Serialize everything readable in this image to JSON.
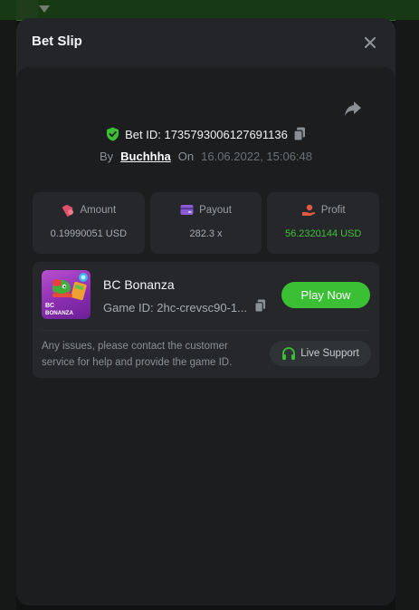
{
  "modal": {
    "title": "Bet Slip",
    "close_icon": "close-icon",
    "share_icon": "share-icon"
  },
  "bet": {
    "id_label": "Bet ID: 1735793006127691136",
    "by_label": "By",
    "user": "Buchhha",
    "on_label": "On",
    "date": "16.06.2022, 15:06:48"
  },
  "stats": [
    {
      "label": "Amount",
      "value": "0.19990051 USD",
      "icon": "amount-icon",
      "color": "#e0506a"
    },
    {
      "label": "Payout",
      "value": "282.3 x",
      "icon": "payout-icon",
      "color": "#8b5cd6"
    },
    {
      "label": "Profit",
      "value": "56.2320144 USD",
      "icon": "profit-icon",
      "color": "#e35940"
    }
  ],
  "game": {
    "name": "BC Bonanza",
    "id_label": "Game ID: 2hc-crevsc90-1...",
    "thumb_text_1": "BC",
    "thumb_text_2": "BONANZA",
    "play_label": "Play Now"
  },
  "support": {
    "text": "Any issues, please contact the customer service for help and provide the game ID.",
    "button_label": "Live Support"
  },
  "colors": {
    "accent_green": "#3bc035",
    "profit_green": "#3bc235",
    "shield_green": "#3bc035"
  }
}
